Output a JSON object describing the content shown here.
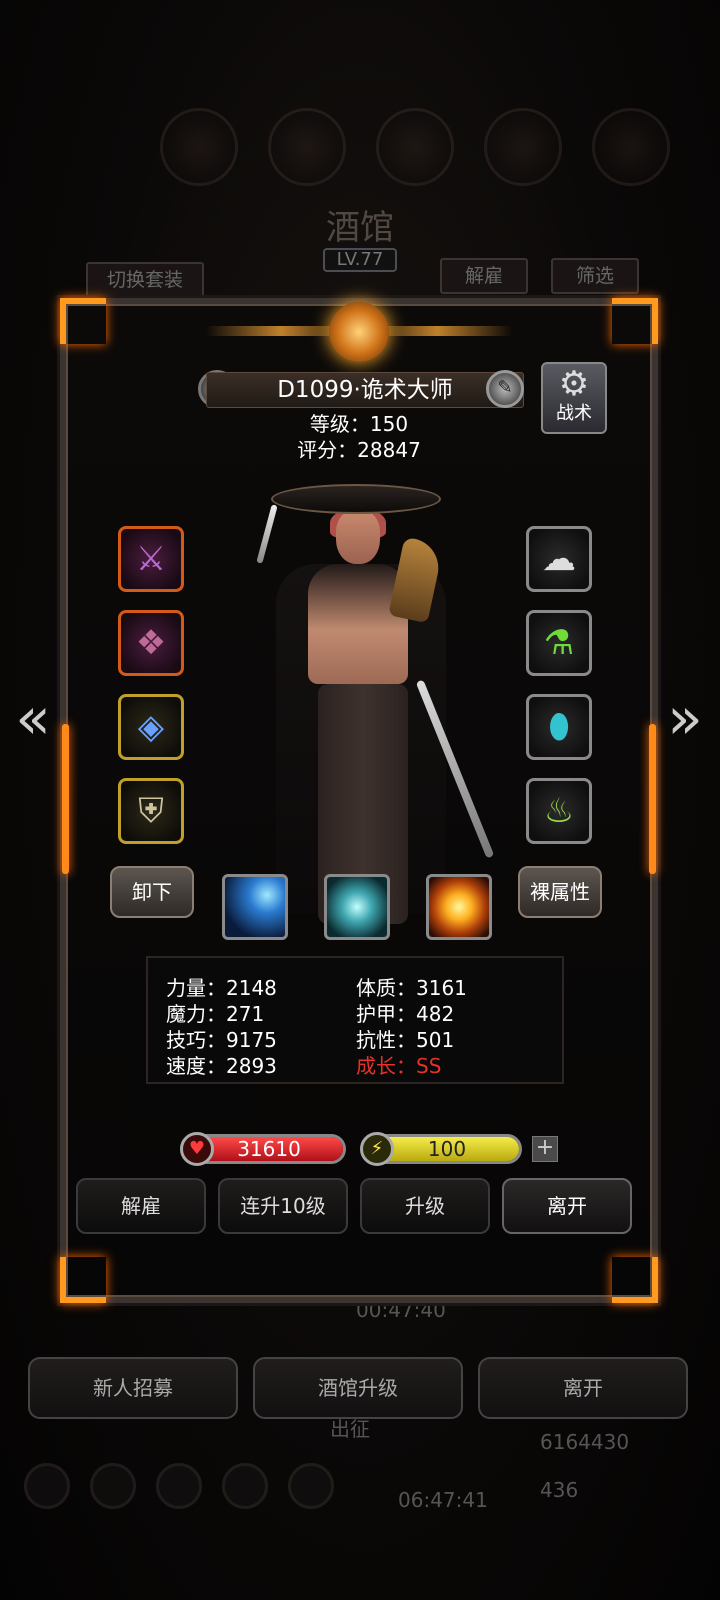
{
  "background": {
    "title": "酒馆",
    "level": "LV.77",
    "switch_outfit": "切换套装",
    "dismiss": "解雇",
    "filter": "筛选",
    "timer_top": "00:47:40",
    "bottom_buttons": [
      "新人招募",
      "酒馆升级",
      "离开"
    ],
    "expedition": "出征",
    "timer_bottom": "06:47:41",
    "gold": "6164430",
    "gems": "436"
  },
  "hero": {
    "name": "D1099·诡术大师",
    "level_line": "等级：150",
    "score_line": "评分：28847",
    "tactics_label": "战术"
  },
  "equipment": {
    "left": [
      "curved-dagger",
      "dark-armor",
      "amulet-necklace",
      "winged-shield"
    ],
    "right": [
      "cloud-ring",
      "green-potion",
      "blue-gem",
      "green-lantern"
    ]
  },
  "actions": {
    "unequip": "卸下",
    "base_attributes": "裸属性"
  },
  "skills": [
    "blue-streak-skill",
    "cyan-slash-skill",
    "fire-burst-skill"
  ],
  "stats": {
    "strength": "力量：2148",
    "constitution": "体质：3161",
    "magic": "魔力：271",
    "armor": "护甲：482",
    "skill": "技巧：9175",
    "resistance": "抗性：501",
    "speed": "速度：2893",
    "growth": "成长：SS"
  },
  "bars": {
    "hp": "31610",
    "energy": "100"
  },
  "footer": {
    "dismiss": "解雇",
    "level_up_10": "连升10级",
    "level_up": "升级",
    "leave": "离开"
  },
  "colors": {
    "accent_orange": "#ff9a1f",
    "hp_red": "#c8141c",
    "energy_yellow": "#e0d21a",
    "growth_red": "#e5322c"
  }
}
